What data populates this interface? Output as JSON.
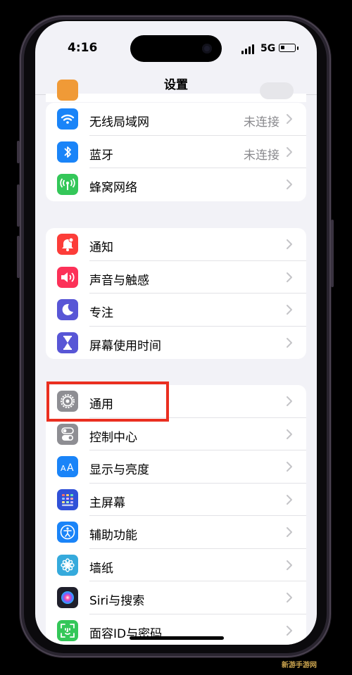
{
  "status": {
    "time": "4:16",
    "network": "5G",
    "battery_level": 0.3
  },
  "nav": {
    "title": "设置"
  },
  "groups": [
    {
      "items": [
        {
          "label": "无线局域网",
          "value": "未连接",
          "icon": "wifi-icon",
          "color": "#1a84f8"
        },
        {
          "label": "蓝牙",
          "value": "未连接",
          "icon": "bluetooth-icon",
          "color": "#1a84f8"
        },
        {
          "label": "蜂窝网络",
          "value": "",
          "icon": "cellular-icon",
          "color": "#34c759"
        }
      ]
    },
    {
      "items": [
        {
          "label": "通知",
          "icon": "bell-icon",
          "color": "#fc3d39"
        },
        {
          "label": "声音与触感",
          "icon": "speaker-icon",
          "color": "#fc3158"
        },
        {
          "label": "专注",
          "icon": "moon-icon",
          "color": "#5856d6"
        },
        {
          "label": "屏幕使用时间",
          "icon": "hourglass-icon",
          "color": "#5856d6"
        }
      ]
    },
    {
      "items": [
        {
          "label": "通用",
          "icon": "gear-icon",
          "color": "#8e8e93"
        },
        {
          "label": "控制中心",
          "icon": "toggles-icon",
          "color": "#8e8e93"
        },
        {
          "label": "显示与亮度",
          "icon": "text-size-icon",
          "color": "#1a84f8"
        },
        {
          "label": "主屏幕",
          "icon": "home-screen-icon",
          "color": "#3051d8"
        },
        {
          "label": "辅助功能",
          "icon": "accessibility-icon",
          "color": "#1a84f8"
        },
        {
          "label": "墙纸",
          "icon": "flower-icon",
          "color": "#35aadc"
        },
        {
          "label": "Siri与搜索",
          "icon": "siri-icon",
          "color": "#1f1f2b"
        },
        {
          "label": "面容ID与密码",
          "icon": "face-id-icon",
          "color": "#34c759"
        }
      ]
    }
  ],
  "watermark": "新游手游网"
}
